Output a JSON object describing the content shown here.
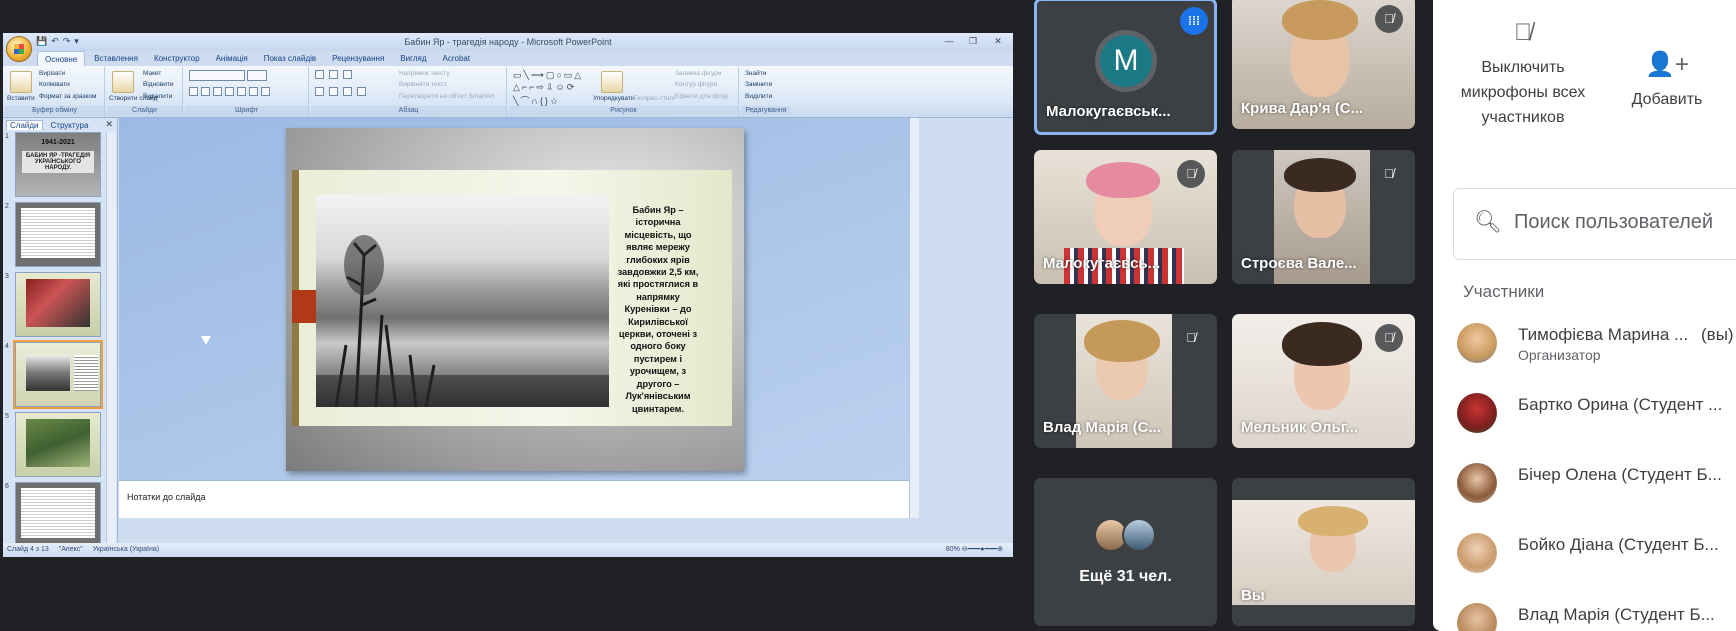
{
  "ppt": {
    "title": "Бабин Яр - трагедія народу - Microsoft PowerPoint",
    "tabs": [
      "Основне",
      "Вставлення",
      "Конструктор",
      "Анімація",
      "Показ слайдів",
      "Рецензування",
      "Вигляд",
      "Acrobat"
    ],
    "ribbon": {
      "clipboard": {
        "label": "Буфер обміну",
        "paste": "Вставити",
        "cut": "Вирізати",
        "copy": "Копіювати",
        "format_painter": "Формат за зразком"
      },
      "slides": {
        "label": "Слайди",
        "new_slide": "Створити слайд",
        "layout": "Макет",
        "reset": "Відновити",
        "delete": "Видалити"
      },
      "font": {
        "label": "Шрифт"
      },
      "paragraph": {
        "label": "Абзац",
        "text_direction": "Напрямок тексту",
        "align_text": "Вирівняти текст",
        "smartart": "Перетворити на об'єкт SmartArt"
      },
      "drawing": {
        "label": "Рисунок",
        "arrange": "Упорядкувати",
        "quick_styles": "Експрес-стилі",
        "shape_fill": "Заливка фігури",
        "shape_outline": "Контур фігури",
        "shape_effects": "Ефекти для фігур"
      },
      "editing": {
        "label": "Редагування",
        "find": "Знайти",
        "replace": "Замінити",
        "select": "Виділити"
      }
    },
    "panel_tabs": {
      "slides": "Слайди",
      "outline": "Структура"
    },
    "thumb1": {
      "date": "1941-2021",
      "title": "БАБИН ЯР -ТРАГЕДІЯ УКРАЇНСЬКОГО НАРОДУ."
    },
    "thumb_numbers": [
      "1",
      "2",
      "3",
      "4",
      "5",
      "6"
    ],
    "slide_text": "Бабин Яр –\nісторична\nмісцевість, що\nявляє мережу\nглибоких ярів\nзавдовжки 2,5 км,\nякі простяглися в\nнапрямку\nКуренівки – до\nКирилівської\nцеркви, оточені з\nодного боку\nпустирем і\nурочищем, з\nдругого –\nЛук'янівським\nцвинтарем.",
    "notes_placeholder": "Нотатки до слайда",
    "status": {
      "slide": "Слайд 4 з 13",
      "theme": "\"Апекс\"",
      "language": "Українська (Україна)",
      "zoom": "80%"
    }
  },
  "tiles": [
    {
      "name": "Малокугаєвськ...",
      "avatar_letter": "M",
      "speaking": true
    },
    {
      "name": "Крива Дар'я (С..."
    },
    {
      "name": "Малокугаєвсь..."
    },
    {
      "name": "Строєва Вале..."
    },
    {
      "name": "Влад Марія (С..."
    },
    {
      "name": "Мельник Ольг..."
    },
    {
      "name": "Ещё 31 чел."
    },
    {
      "name": "Вы"
    }
  ],
  "side": {
    "mute_all": "Выключить микрофоны всех участников",
    "add": "Добавить",
    "search_placeholder": "Поиск пользователей",
    "participants_title": "Участники",
    "participants": [
      {
        "name": "Тимофієва Марина ...",
        "suffix": "(вы)",
        "role": "Организатор"
      },
      {
        "name": "Бартко Орина (Студент ..."
      },
      {
        "name": "Бічер Олена (Студент Б..."
      },
      {
        "name": "Бойко Діана (Студент Б..."
      },
      {
        "name": "Влад Марія (Студент Б..."
      }
    ]
  },
  "colors": {
    "meet_bg": "#202124",
    "speaking": "#1a73e8",
    "avatar_teal": "#1b7a85",
    "slide_accent": "#b13a16"
  }
}
